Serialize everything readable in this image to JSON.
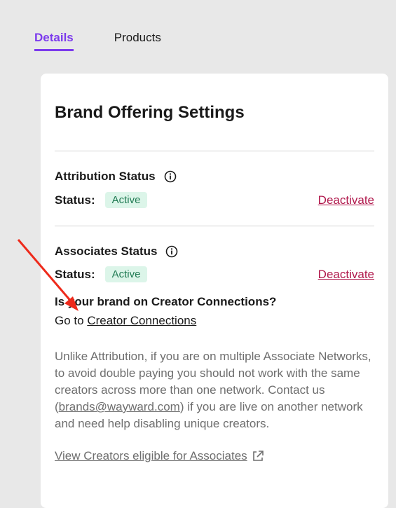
{
  "tabs": [
    {
      "label": "Details",
      "active": true
    },
    {
      "label": "Products",
      "active": false
    }
  ],
  "card": {
    "title": "Brand Offering Settings",
    "attribution": {
      "title": "Attribution Status",
      "status_label": "Status:",
      "badge": "Active",
      "action": "Deactivate"
    },
    "associates": {
      "title": "Associates Status",
      "status_label": "Status:",
      "badge": "Active",
      "action": "Deactivate"
    },
    "question": "Is your brand on Creator Connections?",
    "goto_prefix": "Go to",
    "goto_link": "Creator Connections",
    "body": {
      "part1": "Unlike Attribution, if you are on multiple Associate Networks, to avoid double paying you should not work with the same creators across more than one network. Contact us (",
      "email": "brands@wayward.com",
      "part2": ") if you are live on another network and need help disabling unique creators."
    },
    "view_link": "View Creators eligible for Associates"
  },
  "colors": {
    "accent": "#7c3aed",
    "badge_bg": "#dcf5e9",
    "badge_text": "#1f7a52",
    "deactivate": "#b0174b",
    "annotation_arrow": "#ee2a1b"
  },
  "icons": [
    "info-icon",
    "external-link-icon",
    "annotation-arrow"
  ]
}
